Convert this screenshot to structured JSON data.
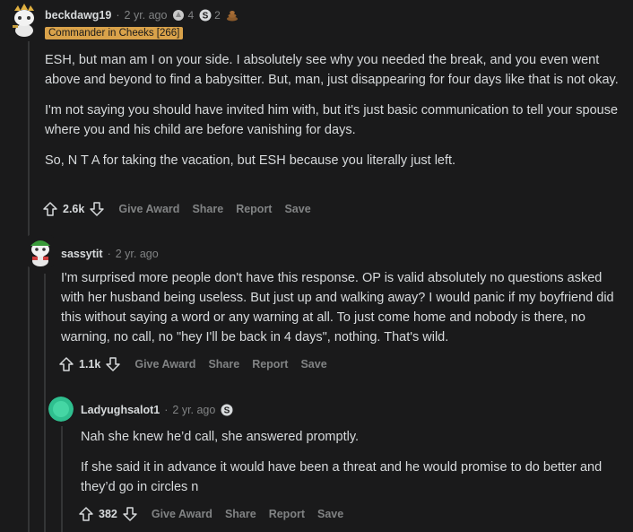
{
  "comments": [
    {
      "username": "beckdawg19",
      "time": "2 yr. ago",
      "awards": [
        {
          "icon": "silver-award-icon",
          "count": "4"
        },
        {
          "icon": "coin-award-icon",
          "count": "2"
        },
        {
          "icon": "poop-award-icon",
          "count": ""
        }
      ],
      "flair": "Commander in Cheeks [266]",
      "paragraphs": [
        "ESH, but man am I on your side. I absolutely see why you needed the break, and you even went above and beyond to find a babysitter. But, man, just disappearing for four days like that is not okay.",
        "I'm not saying you should have invited him with, but it's just basic communication to tell your spouse where you and his child are before vanishing for days.",
        "So, N T A for taking the vacation, but ESH because you literally just left."
      ],
      "score": "2.6k",
      "actions": [
        "Give Award",
        "Share",
        "Report",
        "Save"
      ]
    },
    {
      "username": "sassytit",
      "time": "2 yr. ago",
      "paragraphs": [
        "I'm surprised more people don't have this response. OP is valid absolutely no questions asked with her husband being useless. But just up and walking away? I would panic if my boyfriend did this without saying a word or any warning at all. To just come home and nobody is there, no warning, no call, no \"hey I'll be back in 4 days\", nothing. That's wild."
      ],
      "score": "1.1k",
      "actions": [
        "Give Award",
        "Share",
        "Report",
        "Save"
      ]
    },
    {
      "username": "Ladyughsalot1",
      "time": "2 yr. ago",
      "awards": [
        {
          "icon": "coin-award-icon",
          "count": ""
        }
      ],
      "paragraphs": [
        "Nah she knew he’d call, she answered promptly.",
        "If she said it in advance it would have been a threat and he would promise to do better and they’d go in circles n"
      ],
      "score": "382",
      "actions": [
        "Give Award",
        "Share",
        "Report",
        "Save"
      ]
    }
  ],
  "colors": {
    "background": "#1a1a1b",
    "text": "#d7dadc",
    "muted": "#818384",
    "flair_bg": "#d9a24a",
    "thread_line": "#343536"
  }
}
